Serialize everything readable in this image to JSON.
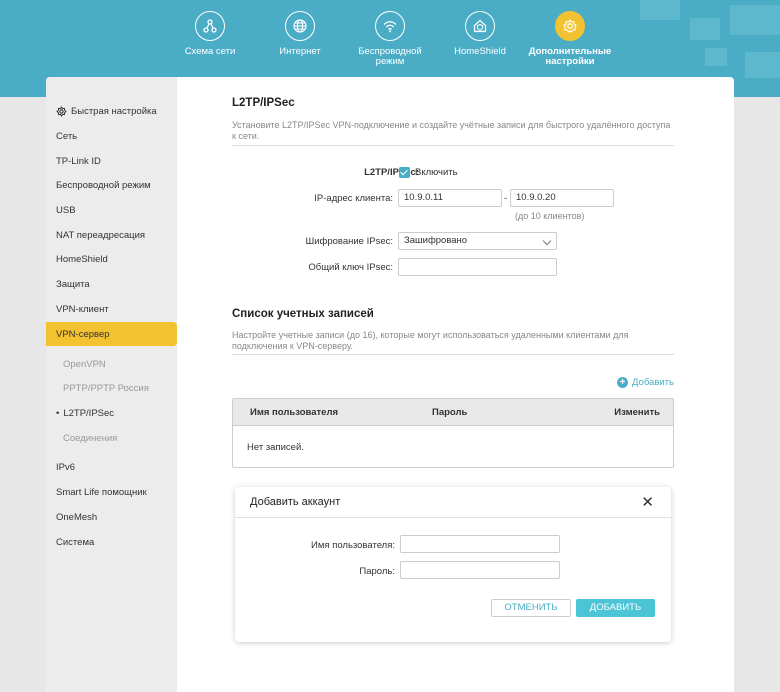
{
  "nav": {
    "items": [
      {
        "label": "Схема сети",
        "icon": "network-map-icon"
      },
      {
        "label": "Интернет",
        "icon": "globe-icon"
      },
      {
        "label": "Беспроводной режим",
        "icon": "wifi-icon"
      },
      {
        "label": "HomeShield",
        "icon": "homeshield-icon"
      },
      {
        "label": "Дополнительные настройки",
        "icon": "gear-icon",
        "active": true
      }
    ]
  },
  "sidebar": {
    "items": [
      "Быстрая настройка",
      "Сеть",
      "TP-Link ID",
      "Беспроводной режим",
      "USB",
      "NAT переадресация",
      "HomeShield",
      "Защита",
      "VPN-клиент",
      "VPN-сервер",
      "IPv6",
      "Smart Life помощник",
      "OneMesh",
      "Система"
    ],
    "sub_items": [
      "OpenVPN",
      "PPTP/PPTP Россия",
      "L2TP/IPSec",
      "Соединения"
    ]
  },
  "section1": {
    "title": "L2TP/IPSec",
    "desc": "Установите L2TP/IPSec VPN-подключение и создайте учётные записи для быстрого удалённого доступа к сети.",
    "enable_label": "L2TP/IPSec:",
    "enable_value": "Включить",
    "ip_label": "IP-адрес клиента:",
    "ip_from": "10.9.0.11",
    "ip_sep": "-",
    "ip_to": "10.9.0.20",
    "ip_hint": "(до 10 клиентов)",
    "enc_label": "Шифрование IPsec:",
    "enc_value": "Зашифровано",
    "psk_label": "Общий ключ IPsec:",
    "psk_value": ""
  },
  "section2": {
    "title": "Список учетных записей",
    "desc": "Настройте учетные записи (до 16), которые могут использоваться удаленными клиентами для подключения к VPN-серверу.",
    "add_label": "Добавить",
    "col_user": "Имя пользователя",
    "col_pass": "Пароль",
    "col_edit": "Изменить",
    "empty": "Нет записей."
  },
  "modal": {
    "title": "Добавить аккаунт",
    "close": "✕",
    "user_label": "Имя пользователя:",
    "pass_label": "Пароль:",
    "cancel": "ОТМЕНИТЬ",
    "add": "ДОБАВИТЬ"
  },
  "colors": {
    "header": "#4bacc6",
    "accent": "#f2c230",
    "primary_button": "#4bc4d6"
  }
}
